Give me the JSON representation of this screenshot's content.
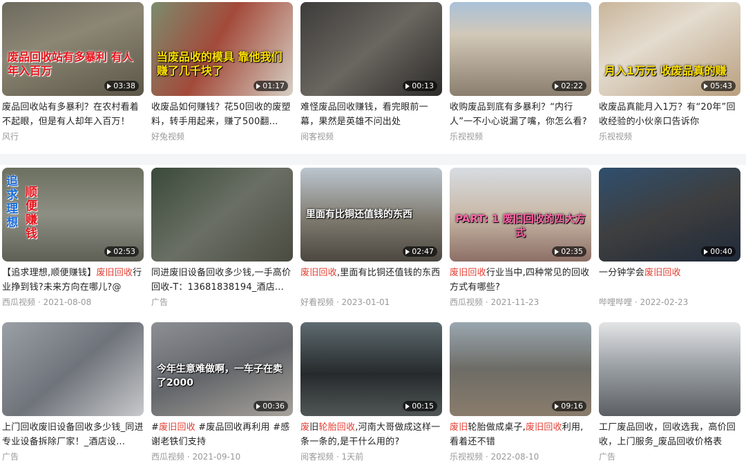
{
  "cards": [
    {
      "overlay": "废品回收站有多暴利 有人年入百万",
      "overlay_style": "red",
      "duration": "03:38",
      "title_parts": [
        {
          "t": "废品回收站有多暴利？在农村看着不起眼，但是有人却年入百万！"
        }
      ],
      "source": "风行",
      "date": ""
    },
    {
      "overlay": "当废品收的模具 靠他我们赚了几千块了",
      "overlay_style": "yellow",
      "duration": "01:17",
      "title_parts": [
        {
          "t": "收废品如何赚钱？花50回收的废塑料，转手用起来，赚了500翻..."
        }
      ],
      "source": "好兔视频",
      "date": ""
    },
    {
      "overlay": "",
      "overlay_style": "",
      "duration": "00:13",
      "title_parts": [
        {
          "t": "难怪废品回收赚钱，看完眼前一幕，果然是英雄不问出处"
        }
      ],
      "source": "阅客视频",
      "date": ""
    },
    {
      "overlay": "",
      "overlay_style": "",
      "duration": "02:22",
      "title_parts": [
        {
          "t": "收购废品到底有多暴利？“内行人”一不小心说漏了嘴，你怎么看?"
        }
      ],
      "source": "乐视视频",
      "date": ""
    },
    {
      "overlay": "月入1万元 收废品真的赚",
      "overlay_style": "yellow",
      "duration": "05:43",
      "title_parts": [
        {
          "t": "收废品真能月入1万？有“20年”回收经验的小伙亲口告诉你"
        }
      ],
      "source": "乐视视频",
      "date": ""
    },
    {
      "overlay": "追求理想",
      "overlay2": "顺便赚钱",
      "overlay_style": "side",
      "duration": "02:53",
      "title_parts": [
        {
          "t": "【追求理想,顺便赚钱】"
        },
        {
          "t": "废旧回收",
          "hl": true
        },
        {
          "t": "行业挣到钱?未来方向在哪儿?@"
        }
      ],
      "source": "西瓜视频",
      "date": "2021-08-08"
    },
    {
      "overlay": "",
      "overlay_style": "",
      "duration": "",
      "title_parts": [
        {
          "t": "同进废旧设备回收多少钱,一手高价回收-T：13681838194_酒店..."
        }
      ],
      "source": "广告",
      "date": ""
    },
    {
      "overlay": "里面有比铜还值钱的东西",
      "overlay_style": "mid",
      "duration": "02:47",
      "title_parts": [
        {
          "t": "废旧回收",
          "hl": true
        },
        {
          "t": ",里面有比铜还值钱的东西"
        }
      ],
      "source": "好看视频",
      "date": "2023-01-01"
    },
    {
      "overlay": "PART: 1 废旧回收的四大方式",
      "overlay_style": "part",
      "duration": "02:35",
      "title_parts": [
        {
          "t": "废旧回收",
          "hl": true
        },
        {
          "t": "行业当中,四种常见的回收方式有哪些?"
        }
      ],
      "source": "西瓜视频",
      "date": "2021-11-23"
    },
    {
      "overlay": "",
      "overlay_style": "",
      "duration": "00:40",
      "title_parts": [
        {
          "t": "一分钟学会"
        },
        {
          "t": "废旧回收",
          "hl": true
        }
      ],
      "source": "哔哩哔哩",
      "date": "2022-02-23"
    },
    {
      "overlay": "",
      "overlay_style": "",
      "duration": "",
      "title_parts": [
        {
          "t": "上门回收废旧设备回收多少钱_同进专业设备拆除厂家！_酒店设..."
        }
      ],
      "source": "广告",
      "date": ""
    },
    {
      "overlay": "今年生意难做啊，一车子在卖了2000",
      "overlay_style": "mid",
      "duration": "00:36",
      "title_parts": [
        {
          "t": "#"
        },
        {
          "t": "废旧回收",
          "hl": true
        },
        {
          "t": " #废品回收再利用 #感谢老铁们支持"
        }
      ],
      "source": "西瓜视频",
      "date": "2021-09-10"
    },
    {
      "overlay": "",
      "overlay_style": "",
      "duration": "00:15",
      "title_parts": [
        {
          "t": "废",
          "hl": true
        },
        {
          "t": "旧"
        },
        {
          "t": "轮胎回收",
          "hl": true
        },
        {
          "t": ",河南大哥做成这样一条一条的,是干什么用的?"
        }
      ],
      "source": "阅客视频",
      "date": "1天前"
    },
    {
      "overlay": "",
      "overlay_style": "",
      "duration": "09:16",
      "title_parts": [
        {
          "t": "废旧",
          "hl": true
        },
        {
          "t": "轮胎做成桌子,"
        },
        {
          "t": "废旧回收",
          "hl": true
        },
        {
          "t": "利用,看着还不错"
        }
      ],
      "source": "乐视视频",
      "date": "2022-08-10"
    },
    {
      "overlay": "",
      "overlay_style": "",
      "duration": "",
      "title_parts": [
        {
          "t": "工厂废品回收，回收选我，高价回收，上门服务_废品回收价格表"
        }
      ],
      "source": "广告",
      "date": ""
    }
  ]
}
